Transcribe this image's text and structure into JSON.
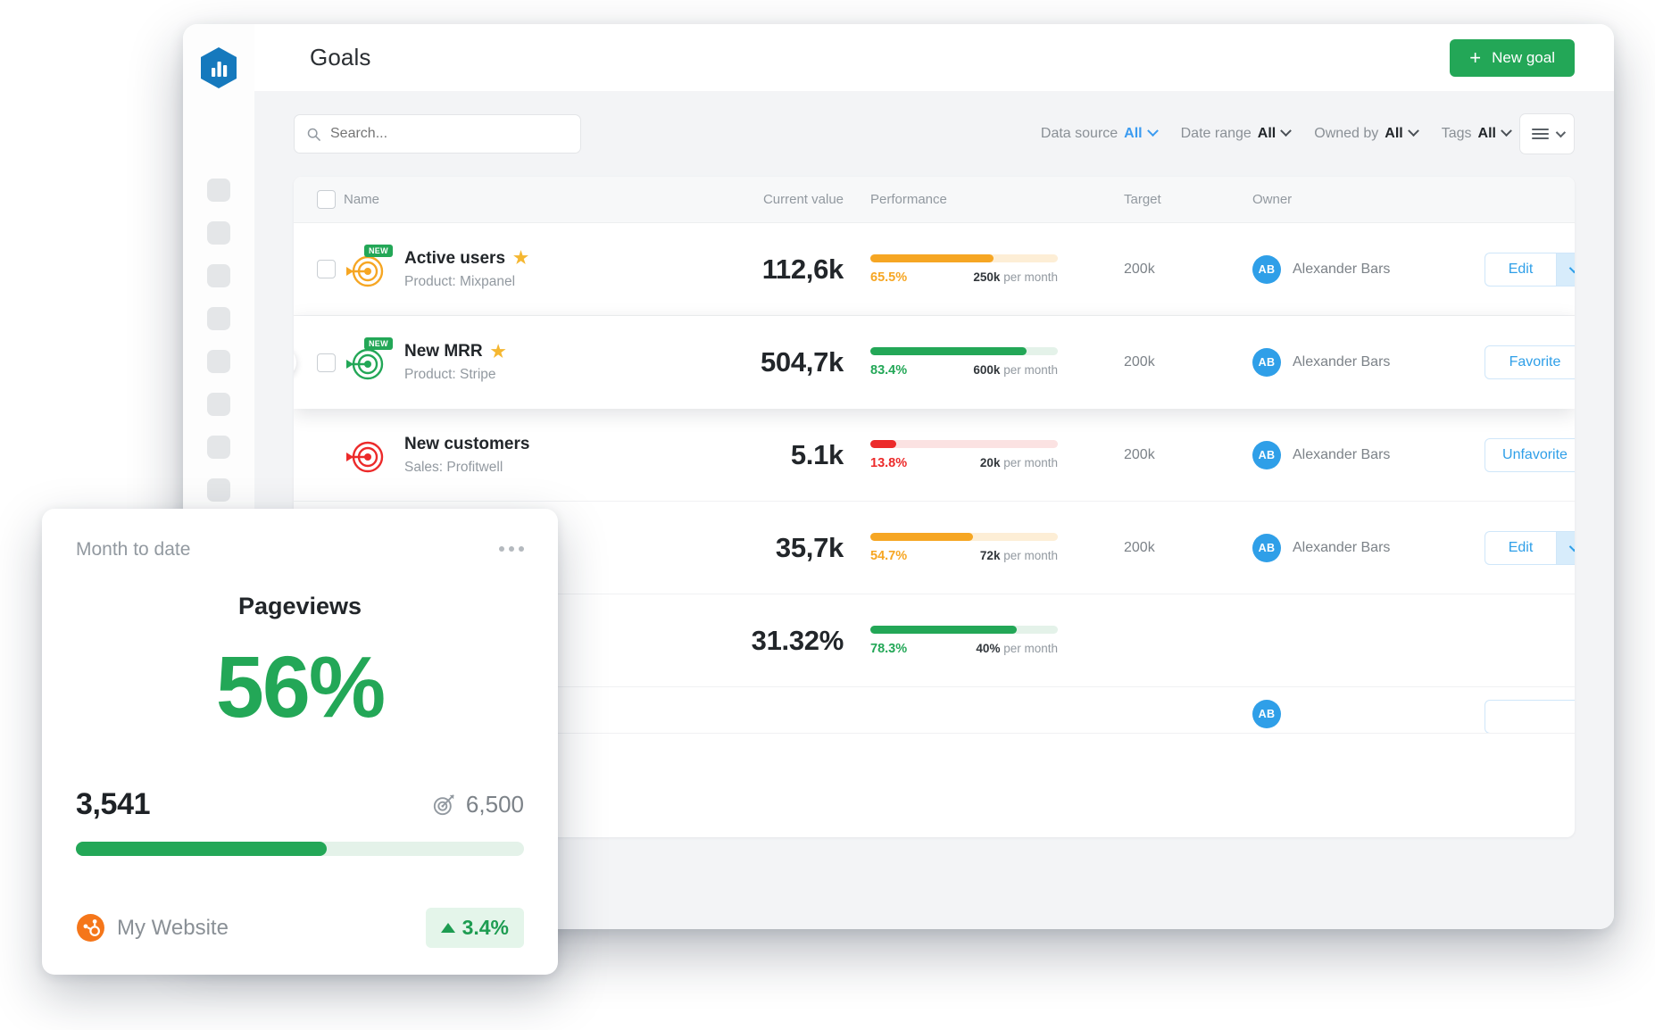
{
  "header": {
    "title": "Goals",
    "new_goal_label": "New goal"
  },
  "search": {
    "placeholder": "Search..."
  },
  "filters": [
    {
      "label": "Data source",
      "value": "All",
      "accent": true
    },
    {
      "label": "Date range",
      "value": "All",
      "accent": false
    },
    {
      "label": "Owned by",
      "value": "All",
      "accent": false
    },
    {
      "label": "Tags",
      "value": "All",
      "accent": false
    }
  ],
  "table": {
    "columns": {
      "name": "Name",
      "current_value": "Current value",
      "performance": "Performance",
      "target": "Target",
      "owner": "Owner"
    },
    "rows": [
      {
        "name": "Active users",
        "subtitle": "Product: Mixpanel",
        "badge": "NEW",
        "starred": true,
        "current_value": "112,6k",
        "percent": "65.5%",
        "percent_fill": 65.5,
        "rate_value": "250k",
        "rate_unit": "per month",
        "target": "200k",
        "owner": "Alexander Bars",
        "owner_initials": "AB",
        "action": "Edit",
        "action_type": "split",
        "color": "#f6a623",
        "track_color": "#fdeed6",
        "icon_color": "#f6a623"
      },
      {
        "name": "New MRR",
        "subtitle": "Product: Stripe",
        "badge": "NEW",
        "starred": true,
        "current_value": "504,7k",
        "percent": "83.4%",
        "percent_fill": 83.4,
        "rate_value": "600k",
        "rate_unit": "per month",
        "target": "200k",
        "owner": "Alexander Bars",
        "owner_initials": "AB",
        "action": "Favorite",
        "action_type": "outline",
        "color": "#23a757",
        "track_color": "#e4f2e9",
        "icon_color": "#23a757"
      },
      {
        "name": "New customers",
        "subtitle": "Sales: Profitwell",
        "badge": "",
        "starred": false,
        "current_value": "5.1k",
        "percent": "13.8%",
        "percent_fill": 13.8,
        "rate_value": "20k",
        "rate_unit": "per month",
        "target": "200k",
        "owner": "Alexander Bars",
        "owner_initials": "AB",
        "action": "Unfavorite",
        "action_type": "outline",
        "color": "#ec2a2a",
        "track_color": "#fbe2e2",
        "icon_color": "#ec2a2a"
      },
      {
        "name": "",
        "subtitle": "",
        "badge": "",
        "starred": false,
        "current_value": "35,7k",
        "percent": "54.7%",
        "percent_fill": 54.7,
        "rate_value": "72k",
        "rate_unit": "per month",
        "target": "200k",
        "owner": "Alexander Bars",
        "owner_initials": "AB",
        "action": "Edit",
        "action_type": "split",
        "color": "#f6a623",
        "track_color": "#fdeed6",
        "icon_color": "#f6a623"
      },
      {
        "name": "",
        "subtitle": "",
        "badge": "",
        "starred": false,
        "current_value": "31.32%",
        "percent": "78.3%",
        "percent_fill": 78.3,
        "rate_value": "40%",
        "rate_unit": "per month",
        "target": "",
        "owner": "",
        "owner_initials": "",
        "action": "",
        "action_type": "none",
        "color": "#23a757",
        "track_color": "#e4f2e9",
        "icon_color": "#23a757"
      }
    ]
  },
  "kpi_card": {
    "period": "Month to date",
    "metric_name": "Pageviews",
    "percent": "56%",
    "percent_fill": 56,
    "current_value": "3,541",
    "goal_value": "6,500",
    "source": "My Website",
    "delta": "3.4%",
    "delta_direction": "up",
    "accent_color": "#23a757"
  },
  "sidebar": {
    "item_count": 8
  }
}
